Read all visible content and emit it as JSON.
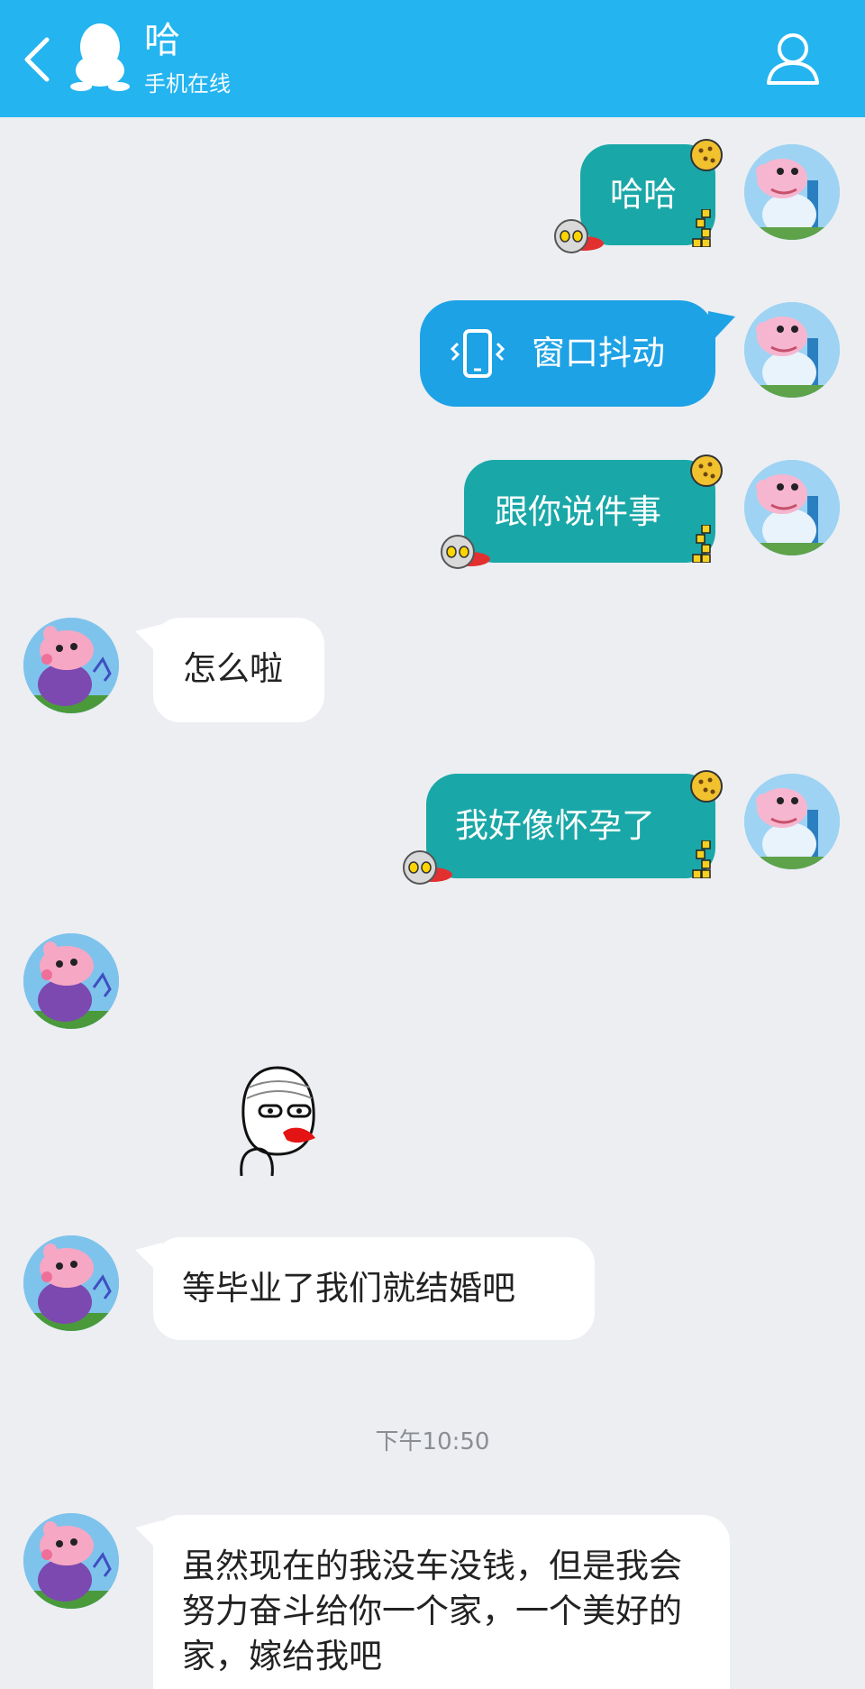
{
  "header": {
    "title": "哈",
    "subtitle": "手机在线",
    "back_icon": "chevron-left-icon",
    "profile_icon": "person-outline-icon"
  },
  "colors": {
    "header_bg": "#24b4f0",
    "chat_bg": "#eceef2",
    "my_bubble": "#1aa7a8",
    "shake_bubble": "#1ea2e6",
    "friend_bubble": "#ffffff"
  },
  "messages": [
    {
      "sender": "me",
      "type": "text",
      "text": "哈哈"
    },
    {
      "sender": "me",
      "type": "shake",
      "text": "窗口抖动",
      "icon": "phone-vibrate-icon"
    },
    {
      "sender": "me",
      "type": "text",
      "text": "跟你说件事"
    },
    {
      "sender": "friend",
      "type": "text",
      "text": "怎么啦"
    },
    {
      "sender": "me",
      "type": "text",
      "text": "我好像怀孕了"
    },
    {
      "sender": "friend",
      "type": "sticker",
      "sticker": "meme-face-bleeding-sticker"
    },
    {
      "sender": "friend",
      "type": "text",
      "text": "等毕业了我们就结婚吧"
    },
    {
      "sender": "friend",
      "type": "text",
      "text": "虽然现在的我没车没钱，但是我会努力奋斗给你一个家，一个美好的家，嫁给我吧"
    }
  ],
  "timestamp": "下午10:50"
}
